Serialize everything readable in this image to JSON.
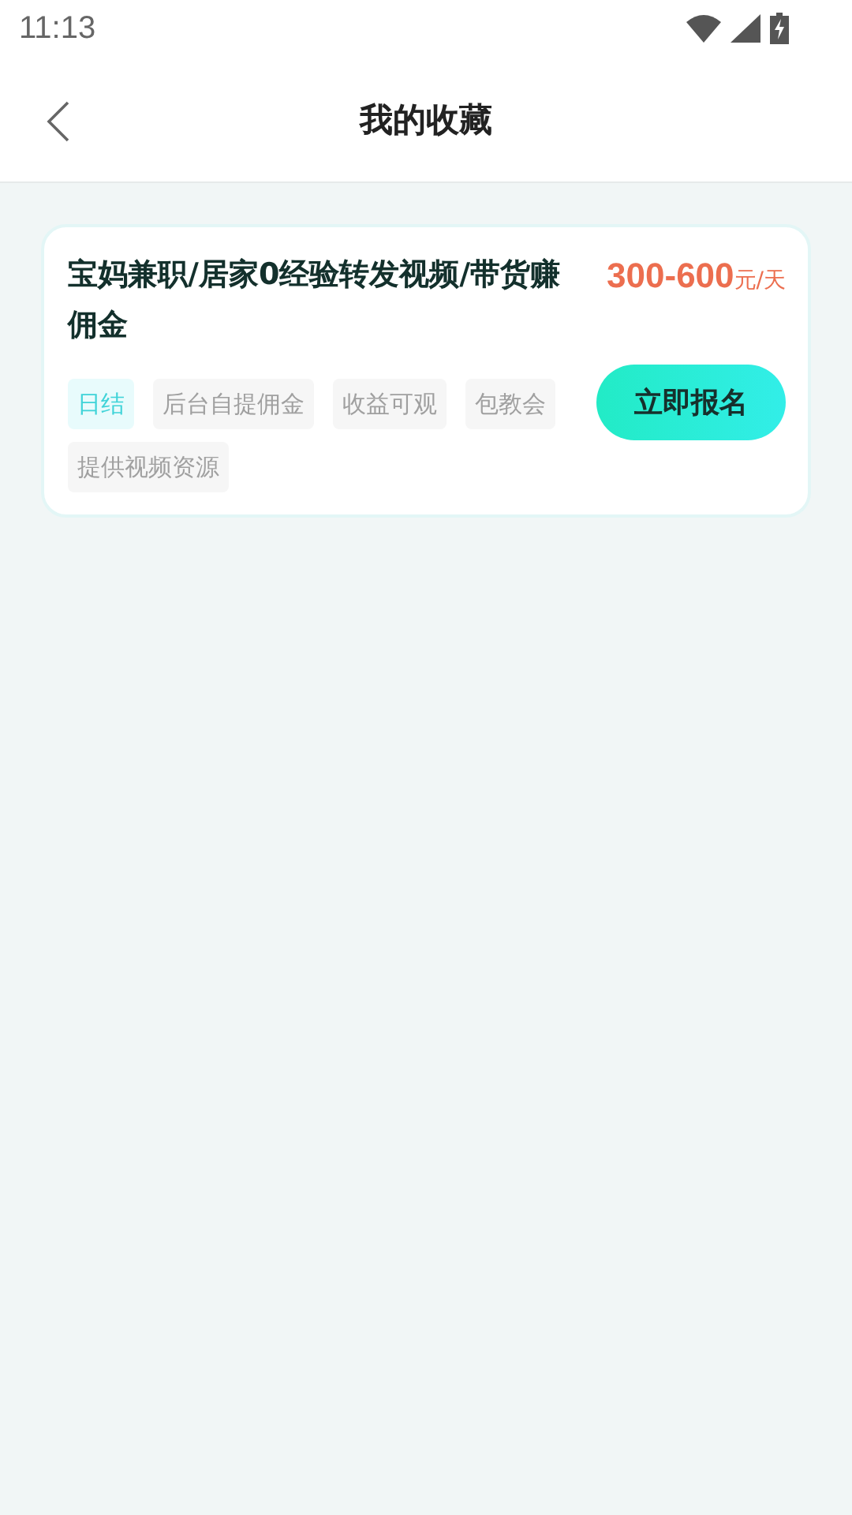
{
  "status_bar": {
    "time": "11:13"
  },
  "header": {
    "title": "我的收藏"
  },
  "jobs": [
    {
      "title": "宝妈兼职/居家0经验转发视频/带货赚佣金",
      "salary": "300-600",
      "unit": "元/天",
      "tags": [
        {
          "label": "日结",
          "highlighted": true
        },
        {
          "label": "后台自提佣金",
          "highlighted": false
        },
        {
          "label": "收益可观",
          "highlighted": false
        },
        {
          "label": "包教会",
          "highlighted": false
        },
        {
          "label": "提供视频资源",
          "highlighted": false
        }
      ],
      "button": "立即报名"
    }
  ]
}
